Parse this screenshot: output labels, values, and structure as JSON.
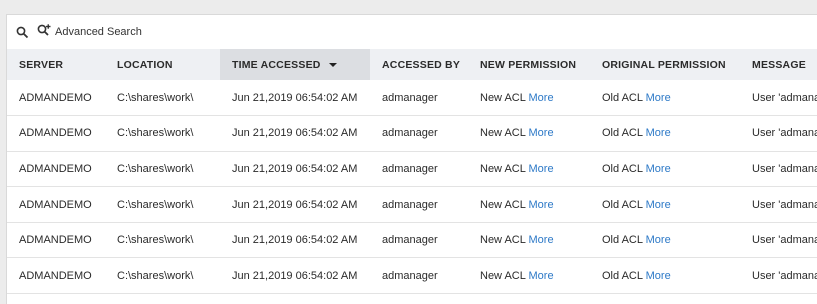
{
  "toolbar": {
    "search_icon": "search-icon",
    "advanced_search_icon": "search-plus-icon",
    "advanced_search_label": "Advanced Search"
  },
  "table": {
    "columns": [
      {
        "key": "server",
        "label": "SERVER"
      },
      {
        "key": "location",
        "label": "LOCATION"
      },
      {
        "key": "time_accessed",
        "label": "TIME ACCESSED",
        "sorted": "desc"
      },
      {
        "key": "accessed_by",
        "label": "ACCESSED BY"
      },
      {
        "key": "new_permission",
        "label": "NEW PERMISSION"
      },
      {
        "key": "original_permission",
        "label": "ORIGINAL PERMISSION"
      },
      {
        "key": "message",
        "label": "MESSAGE"
      }
    ],
    "rows": [
      {
        "server": "ADMANDEMO",
        "location": "C:\\shares\\work\\",
        "time_accessed": "Jun 21,2019 06:54:02 AM",
        "accessed_by": "admanager",
        "new_acl": "New ACL",
        "new_more": "More",
        "orig_acl": "Old ACL",
        "orig_more": "More",
        "message": "User 'admanager'"
      },
      {
        "server": "ADMANDEMO",
        "location": "C:\\shares\\work\\",
        "time_accessed": "Jun 21,2019 06:54:02 AM",
        "accessed_by": "admanager",
        "new_acl": "New ACL",
        "new_more": "More",
        "orig_acl": "Old ACL",
        "orig_more": "More",
        "message": "User 'admanager'"
      },
      {
        "server": "ADMANDEMO",
        "location": "C:\\shares\\work\\",
        "time_accessed": "Jun 21,2019 06:54:02 AM",
        "accessed_by": "admanager",
        "new_acl": "New ACL",
        "new_more": "More",
        "orig_acl": "Old ACL",
        "orig_more": "More",
        "message": "User 'admanager'"
      },
      {
        "server": "ADMANDEMO",
        "location": "C:\\shares\\work\\",
        "time_accessed": "Jun 21,2019 06:54:02 AM",
        "accessed_by": "admanager",
        "new_acl": "New ACL",
        "new_more": "More",
        "orig_acl": "Old ACL",
        "orig_more": "More",
        "message": "User 'admanager'"
      },
      {
        "server": "ADMANDEMO",
        "location": "C:\\shares\\work\\",
        "time_accessed": "Jun 21,2019 06:54:02 AM",
        "accessed_by": "admanager",
        "new_acl": "New ACL",
        "new_more": "More",
        "orig_acl": "Old ACL",
        "orig_more": "More",
        "message": "User 'admanager'"
      },
      {
        "server": "ADMANDEMO",
        "location": "C:\\shares\\work\\",
        "time_accessed": "Jun 21,2019 06:54:02 AM",
        "accessed_by": "admanager",
        "new_acl": "New ACL",
        "new_more": "More",
        "orig_acl": "Old ACL",
        "orig_more": "More",
        "message": "User 'admanager'"
      }
    ]
  },
  "colors": {
    "link": "#2d79c7",
    "header_bg": "#eef0f3",
    "sorted_header_bg": "#dcdee2"
  }
}
